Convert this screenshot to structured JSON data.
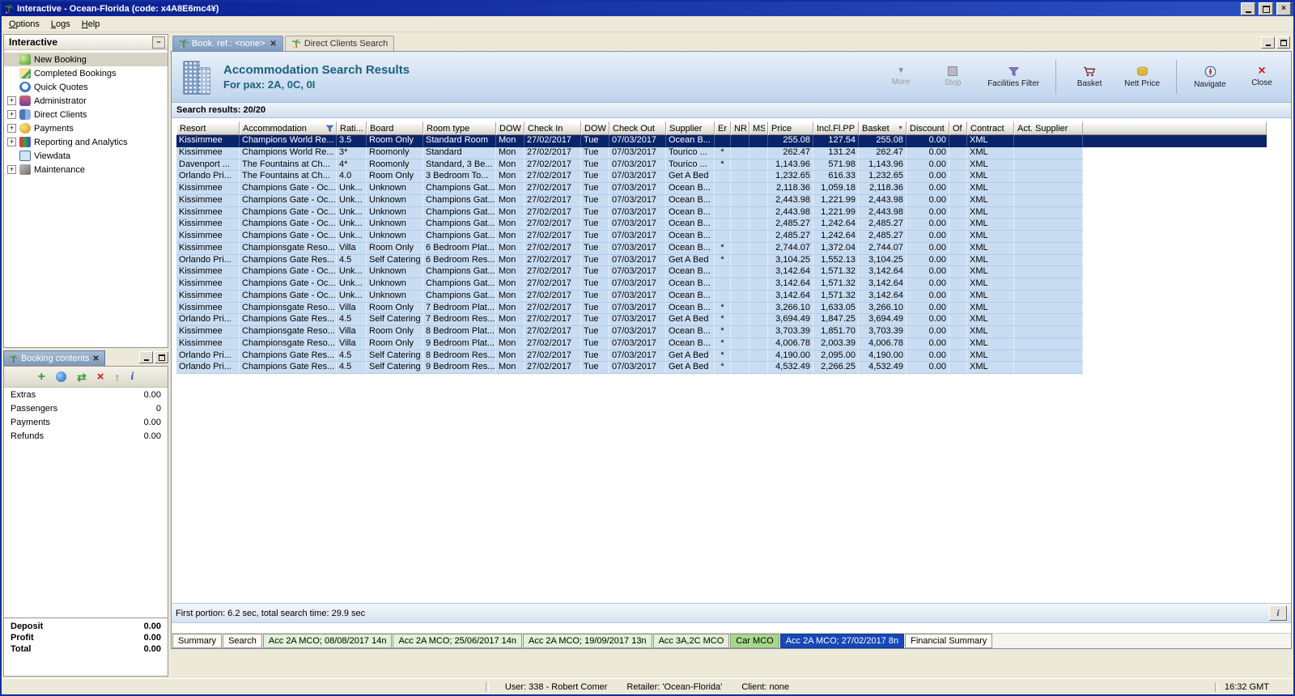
{
  "titlebar": {
    "title": "Interactive - Ocean-Florida (code: x4A8E6mc4¥)"
  },
  "menu": {
    "items": [
      "Options",
      "Logs",
      "Help"
    ]
  },
  "sidebar": {
    "title": "Interactive",
    "items": [
      {
        "label": "New Booking",
        "icon": "new-booking-icon",
        "selected": true,
        "expandable": false
      },
      {
        "label": "Completed Bookings",
        "icon": "completed-bookings-icon",
        "expandable": false
      },
      {
        "label": "Quick Quotes",
        "icon": "quick-quotes-icon",
        "expandable": false
      },
      {
        "label": "Administrator",
        "icon": "administrator-icon",
        "expandable": true
      },
      {
        "label": "Direct Clients",
        "icon": "direct-clients-icon",
        "expandable": true
      },
      {
        "label": "Payments",
        "icon": "payments-icon",
        "expandable": true
      },
      {
        "label": "Reporting and Analytics",
        "icon": "reporting-icon",
        "expandable": true
      },
      {
        "label": "Viewdata",
        "icon": "viewdata-icon",
        "expandable": false
      },
      {
        "label": "Maintenance",
        "icon": "maintenance-icon",
        "expandable": true
      }
    ]
  },
  "booking_contents": {
    "title": "Booking contents",
    "rows": [
      {
        "label": "Extras",
        "value": "0.00"
      },
      {
        "label": "Passengers",
        "value": "0"
      },
      {
        "label": "Payments",
        "value": "0.00"
      },
      {
        "label": "Refunds",
        "value": "0.00"
      }
    ],
    "summary": [
      {
        "label": "Deposit",
        "value": "0.00"
      },
      {
        "label": "Profit",
        "value": "0.00"
      },
      {
        "label": "Total",
        "value": "0.00"
      }
    ]
  },
  "main": {
    "tabs": [
      {
        "label": "Book. ref.: <none>",
        "active": true
      },
      {
        "label": "Direct Clients Search",
        "active": false
      }
    ],
    "header": {
      "title": "Accommodation Search Results",
      "subtitle": "For pax: 2A, 0C, 0I"
    },
    "toolbar": {
      "more": "More",
      "stop": "Stop",
      "facilities_filter": "Facilities Filter",
      "basket": "Basket",
      "nett_price": "Nett Price",
      "navigate": "Navigate",
      "close": "Close"
    },
    "results_label": "Search results: 20/20",
    "status_line": "First portion: 6.2 sec, total search time: 29.9 sec",
    "bottom_tabs": [
      {
        "label": "Summary",
        "type": "plain"
      },
      {
        "label": "Search",
        "type": "plain"
      },
      {
        "label": "Acc 2A MCO; 08/08/2017 14n",
        "type": "acc"
      },
      {
        "label": "Acc 2A MCO; 25/06/2017 14n",
        "type": "acc"
      },
      {
        "label": "Acc 2A MCO; 19/09/2017 13n",
        "type": "acc"
      },
      {
        "label": "Acc 3A,2C MCO",
        "type": "acc"
      },
      {
        "label": "Car MCO",
        "type": "car"
      },
      {
        "label": "Acc 2A MCO; 27/02/2017 8n",
        "type": "active"
      },
      {
        "label": "Financial Summary",
        "type": "plain"
      }
    ]
  },
  "results_table": {
    "columns": [
      "Resort",
      "Accommodation",
      "Rati...",
      "Board",
      "Room type",
      "DOW",
      "Check In",
      "DOW",
      "Check Out",
      "Supplier",
      "Er",
      "NR",
      "MS",
      "Price",
      "Incl.Fl.PP",
      "Basket",
      "Discount",
      "Of",
      "Contract",
      "Act. Supplier"
    ],
    "filter_column": "Accommodation",
    "sorted_column": "Basket",
    "rows": [
      {
        "selected": true,
        "cells": [
          "Kissimmee",
          "Champions World Re...",
          "3.5",
          "Room Only",
          "Standard Room",
          "Mon",
          "27/02/2017",
          "Tue",
          "07/03/2017",
          "Ocean B...",
          "",
          "",
          "",
          "255.08",
          "127.54",
          "255.08",
          "0.00",
          "",
          "XML",
          ""
        ]
      },
      {
        "cells": [
          "Kissimmee",
          "Champions World Re...",
          "3*",
          "Roomonly",
          "Standard",
          "Mon",
          "27/02/2017",
          "Tue",
          "07/03/2017",
          "Tourico ...",
          "*",
          "",
          "",
          "262.47",
          "131.24",
          "262.47",
          "0.00",
          "",
          "XML",
          ""
        ]
      },
      {
        "cells": [
          "Davenport ...",
          "The Fountains at Ch...",
          "4*",
          "Roomonly",
          "Standard, 3 Be...",
          "Mon",
          "27/02/2017",
          "Tue",
          "07/03/2017",
          "Tourico ...",
          "*",
          "",
          "",
          "1,143.96",
          "571.98",
          "1,143.96",
          "0.00",
          "",
          "XML",
          ""
        ]
      },
      {
        "cells": [
          "Orlando Pri...",
          "The Fountains at Ch...",
          "4.0",
          "Room Only",
          "3 Bedroom To...",
          "Mon",
          "27/02/2017",
          "Tue",
          "07/03/2017",
          "Get A Bed",
          "",
          "",
          "",
          "1,232.65",
          "616.33",
          "1,232.65",
          "0.00",
          "",
          "XML",
          ""
        ]
      },
      {
        "cells": [
          "Kissimmee",
          "Champions Gate - Oc...",
          "Unk...",
          "Unknown",
          "Champions Gat...",
          "Mon",
          "27/02/2017",
          "Tue",
          "07/03/2017",
          "Ocean B...",
          "",
          "",
          "",
          "2,118.36",
          "1,059.18",
          "2,118.36",
          "0.00",
          "",
          "XML",
          ""
        ]
      },
      {
        "cells": [
          "Kissimmee",
          "Champions Gate - Oc...",
          "Unk...",
          "Unknown",
          "Champions Gat...",
          "Mon",
          "27/02/2017",
          "Tue",
          "07/03/2017",
          "Ocean B...",
          "",
          "",
          "",
          "2,443.98",
          "1,221.99",
          "2,443.98",
          "0.00",
          "",
          "XML",
          ""
        ]
      },
      {
        "cells": [
          "Kissimmee",
          "Champions Gate - Oc...",
          "Unk...",
          "Unknown",
          "Champions Gat...",
          "Mon",
          "27/02/2017",
          "Tue",
          "07/03/2017",
          "Ocean B...",
          "",
          "",
          "",
          "2,443.98",
          "1,221.99",
          "2,443.98",
          "0.00",
          "",
          "XML",
          ""
        ]
      },
      {
        "cells": [
          "Kissimmee",
          "Champions Gate - Oc...",
          "Unk...",
          "Unknown",
          "Champions Gat...",
          "Mon",
          "27/02/2017",
          "Tue",
          "07/03/2017",
          "Ocean B...",
          "",
          "",
          "",
          "2,485.27",
          "1,242.64",
          "2,485.27",
          "0.00",
          "",
          "XML",
          ""
        ]
      },
      {
        "cells": [
          "Kissimmee",
          "Champions Gate - Oc...",
          "Unk...",
          "Unknown",
          "Champions Gat...",
          "Mon",
          "27/02/2017",
          "Tue",
          "07/03/2017",
          "Ocean B...",
          "",
          "",
          "",
          "2,485.27",
          "1,242.64",
          "2,485.27",
          "0.00",
          "",
          "XML",
          ""
        ]
      },
      {
        "cells": [
          "Kissimmee",
          "Championsgate Reso...",
          "Villa",
          "Room Only",
          "6 Bedroom Plat...",
          "Mon",
          "27/02/2017",
          "Tue",
          "07/03/2017",
          "Ocean B...",
          "*",
          "",
          "",
          "2,744.07",
          "1,372.04",
          "2,744.07",
          "0.00",
          "",
          "XML",
          ""
        ]
      },
      {
        "cells": [
          "Orlando Pri...",
          "Champions Gate Res...",
          "4.5",
          "Self Catering",
          "6 Bedroom Res...",
          "Mon",
          "27/02/2017",
          "Tue",
          "07/03/2017",
          "Get A Bed",
          "*",
          "",
          "",
          "3,104.25",
          "1,552.13",
          "3,104.25",
          "0.00",
          "",
          "XML",
          ""
        ]
      },
      {
        "cells": [
          "Kissimmee",
          "Champions Gate - Oc...",
          "Unk...",
          "Unknown",
          "Champions Gat...",
          "Mon",
          "27/02/2017",
          "Tue",
          "07/03/2017",
          "Ocean B...",
          "",
          "",
          "",
          "3,142.64",
          "1,571.32",
          "3,142.64",
          "0.00",
          "",
          "XML",
          ""
        ]
      },
      {
        "cells": [
          "Kissimmee",
          "Champions Gate - Oc...",
          "Unk...",
          "Unknown",
          "Champions Gat...",
          "Mon",
          "27/02/2017",
          "Tue",
          "07/03/2017",
          "Ocean B...",
          "",
          "",
          "",
          "3,142.64",
          "1,571.32",
          "3,142.64",
          "0.00",
          "",
          "XML",
          ""
        ]
      },
      {
        "cells": [
          "Kissimmee",
          "Champions Gate - Oc...",
          "Unk...",
          "Unknown",
          "Champions Gat...",
          "Mon",
          "27/02/2017",
          "Tue",
          "07/03/2017",
          "Ocean B...",
          "",
          "",
          "",
          "3,142.64",
          "1,571.32",
          "3,142.64",
          "0.00",
          "",
          "XML",
          ""
        ]
      },
      {
        "cells": [
          "Kissimmee",
          "Championsgate Reso...",
          "Villa",
          "Room Only",
          "7 Bedroom Plat...",
          "Mon",
          "27/02/2017",
          "Tue",
          "07/03/2017",
          "Ocean B...",
          "*",
          "",
          "",
          "3,266.10",
          "1,633.05",
          "3,266.10",
          "0.00",
          "",
          "XML",
          ""
        ]
      },
      {
        "cells": [
          "Orlando Pri...",
          "Champions Gate Res...",
          "4.5",
          "Self Catering",
          "7 Bedroom Res...",
          "Mon",
          "27/02/2017",
          "Tue",
          "07/03/2017",
          "Get A Bed",
          "*",
          "",
          "",
          "3,694.49",
          "1,847.25",
          "3,694.49",
          "0.00",
          "",
          "XML",
          ""
        ]
      },
      {
        "cells": [
          "Kissimmee",
          "Championsgate Reso...",
          "Villa",
          "Room Only",
          "8 Bedroom Plat...",
          "Mon",
          "27/02/2017",
          "Tue",
          "07/03/2017",
          "Ocean B...",
          "*",
          "",
          "",
          "3,703.39",
          "1,851.70",
          "3,703.39",
          "0.00",
          "",
          "XML",
          ""
        ]
      },
      {
        "cells": [
          "Kissimmee",
          "Championsgate Reso...",
          "Villa",
          "Room Only",
          "9 Bedroom Plat...",
          "Mon",
          "27/02/2017",
          "Tue",
          "07/03/2017",
          "Ocean B...",
          "*",
          "",
          "",
          "4,006.78",
          "2,003.39",
          "4,006.78",
          "0.00",
          "",
          "XML",
          ""
        ]
      },
      {
        "cells": [
          "Orlando Pri...",
          "Champions Gate Res...",
          "4.5",
          "Self Catering",
          "8 Bedroom Res...",
          "Mon",
          "27/02/2017",
          "Tue",
          "07/03/2017",
          "Get A Bed",
          "*",
          "",
          "",
          "4,190.00",
          "2,095.00",
          "4,190.00",
          "0.00",
          "",
          "XML",
          ""
        ]
      },
      {
        "cells": [
          "Orlando Pri...",
          "Champions Gate Res...",
          "4.5",
          "Self Catering",
          "9 Bedroom Res...",
          "Mon",
          "27/02/2017",
          "Tue",
          "07/03/2017",
          "Get A Bed",
          "*",
          "",
          "",
          "4,532.49",
          "2,266.25",
          "4,532.49",
          "0.00",
          "",
          "XML",
          ""
        ]
      }
    ]
  },
  "statusbar": {
    "user": "User: 338 - Robert Comer",
    "retailer": "Retailer: 'Ocean-Florida'",
    "client": "Client: none",
    "clock": "16:32 GMT"
  },
  "colors": {
    "selected_row": "#0a246a",
    "row_bg": "#c8ddf2",
    "active_bottom_tab": "#1747b8",
    "acc_tab": "#e0f2d8",
    "car_tab": "#a6d88a",
    "titlebar": "#0a1e90"
  }
}
